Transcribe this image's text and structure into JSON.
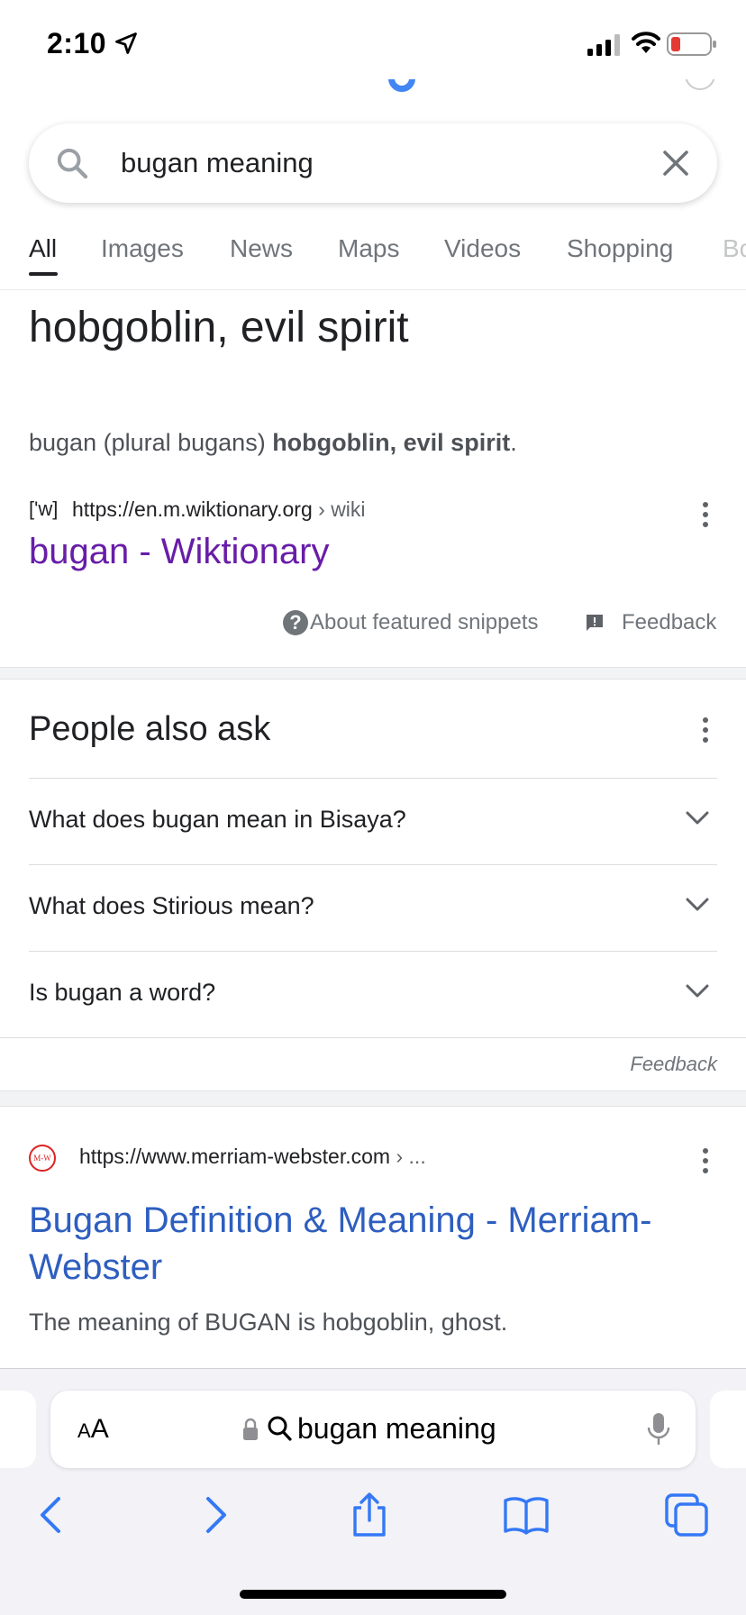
{
  "status_bar": {
    "time": "2:10"
  },
  "search": {
    "query": "bugan meaning"
  },
  "tabs": [
    "All",
    "Images",
    "News",
    "Maps",
    "Videos",
    "Shopping",
    "Bo"
  ],
  "snippet": {
    "heading": "hobgoblin, evil spirit",
    "text_prefix": "bugan (plural bugans) ",
    "text_bold": "hobgoblin, evil spirit",
    "text_suffix": ".",
    "source_favicon": "['w]",
    "source_url": "https://en.m.wiktionary.org",
    "source_crumb": " › wiki",
    "title": "bugan - Wiktionary",
    "about_label": "About featured snippets",
    "feedback_label": "Feedback"
  },
  "paa": {
    "title": "People also ask",
    "questions": [
      "What does bugan mean in Bisaya?",
      "What does Stirious mean?",
      "Is bugan a word?"
    ],
    "feedback_label": "Feedback"
  },
  "result_mw": {
    "favicon": "M-W",
    "url": "https://www.merriam-webster.com",
    "crumb": " › ...",
    "title": "Bugan Definition & Meaning - Merriam-Webster",
    "description": "The meaning of BUGAN is hobgoblin, ghost."
  },
  "safari": {
    "aa_label": "AA",
    "address_text": "bugan meaning"
  },
  "colors": {
    "visited_link": "#681da8",
    "link": "#2e5ebf",
    "accent_blue": "#4285f4",
    "battery_low": "#e53935"
  }
}
